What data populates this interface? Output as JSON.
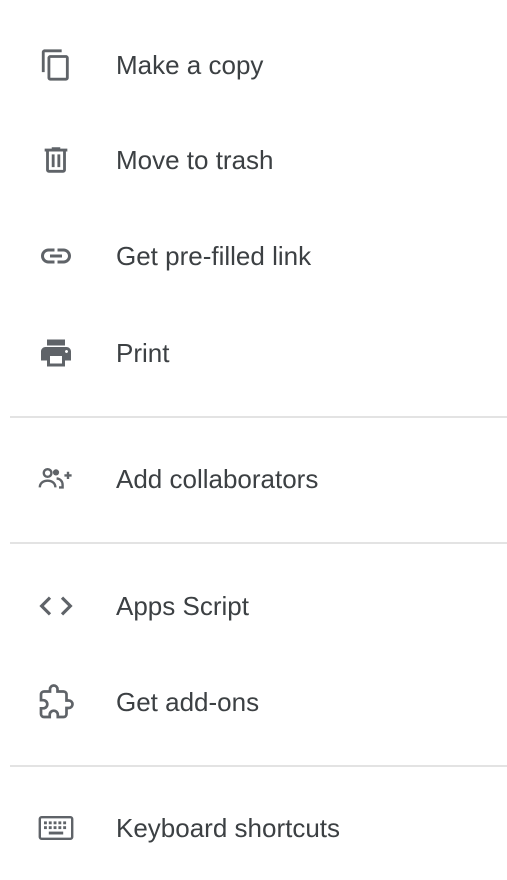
{
  "menu": {
    "items": [
      {
        "label": "Make a copy",
        "icon": "copy-icon"
      },
      {
        "label": "Move to trash",
        "icon": "trash-icon"
      },
      {
        "label": "Get pre-filled link",
        "icon": "link-icon"
      },
      {
        "label": "Print",
        "icon": "printer-icon"
      },
      {
        "label": "Add collaborators",
        "icon": "add-people-icon"
      },
      {
        "label": "Apps Script",
        "icon": "code-icon"
      },
      {
        "label": "Get add-ons",
        "icon": "puzzle-icon"
      },
      {
        "label": "Keyboard shortcuts",
        "icon": "keyboard-icon"
      }
    ]
  },
  "colors": {
    "text": "#3c4043",
    "icon": "#5f6368",
    "divider": "#e3e3e3",
    "background": "#ffffff"
  }
}
